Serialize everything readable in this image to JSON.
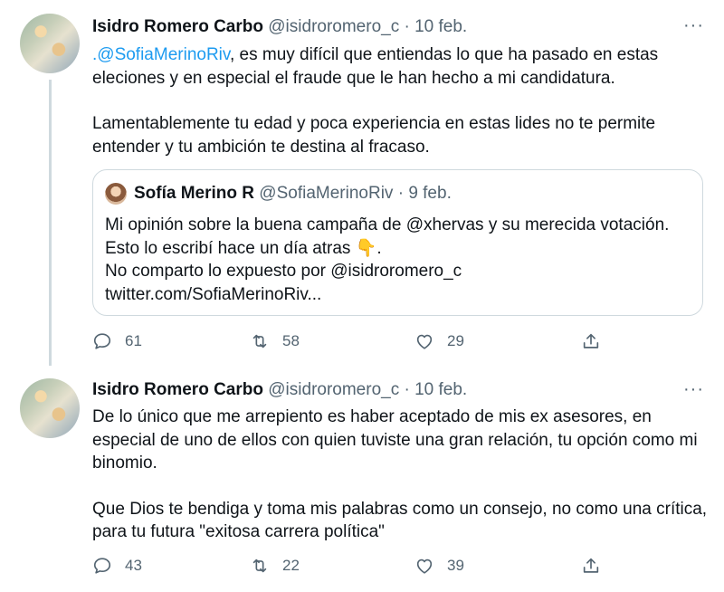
{
  "tweets": [
    {
      "author_name": "Isidro Romero Carbo",
      "author_handle": "@isidroromero_c",
      "separator": "·",
      "date": "10 feb.",
      "more": "···",
      "mention": ".@SofiaMerinoRiv",
      "paragraph1_rest": ", es muy difícil que entiendas lo que ha pasado en estas eleciones y en especial el fraude que le han hecho a mi candidatura.",
      "paragraph2": "Lamentablemente tu edad y poca experiencia en estas lides no te permite entender y tu ambición te destina al fracaso.",
      "quoted": {
        "author_name": "Sofía Merino R",
        "author_handle": "@SofiaMerinoRiv",
        "separator": "·",
        "date": "9 feb.",
        "line1": "Mi opinión sobre la buena campaña de @xhervas y su merecida votación. Esto lo escribí hace un día atras 👇.",
        "line2": "No comparto lo expuesto por @isidroromero_c",
        "line3": "twitter.com/SofiaMerinoRiv..."
      },
      "stats": {
        "replies": "61",
        "retweets": "58",
        "likes": "29"
      }
    },
    {
      "author_name": "Isidro Romero Carbo",
      "author_handle": "@isidroromero_c",
      "separator": "·",
      "date": "10 feb.",
      "more": "···",
      "paragraph1": "De lo único que me arrepiento es haber aceptado de mis ex asesores, en especial de uno de ellos con quien tuviste una gran relación, tu opción como mi binomio.",
      "paragraph2": "Que Dios te bendiga y toma mis palabras como un consejo, no como una crítica, para tu futura \"exitosa carrera política\"",
      "stats": {
        "replies": "43",
        "retweets": "22",
        "likes": "39"
      }
    }
  ],
  "colors": {
    "link": "#1d9bf0",
    "muted": "#536471",
    "border": "#cfd9de"
  }
}
